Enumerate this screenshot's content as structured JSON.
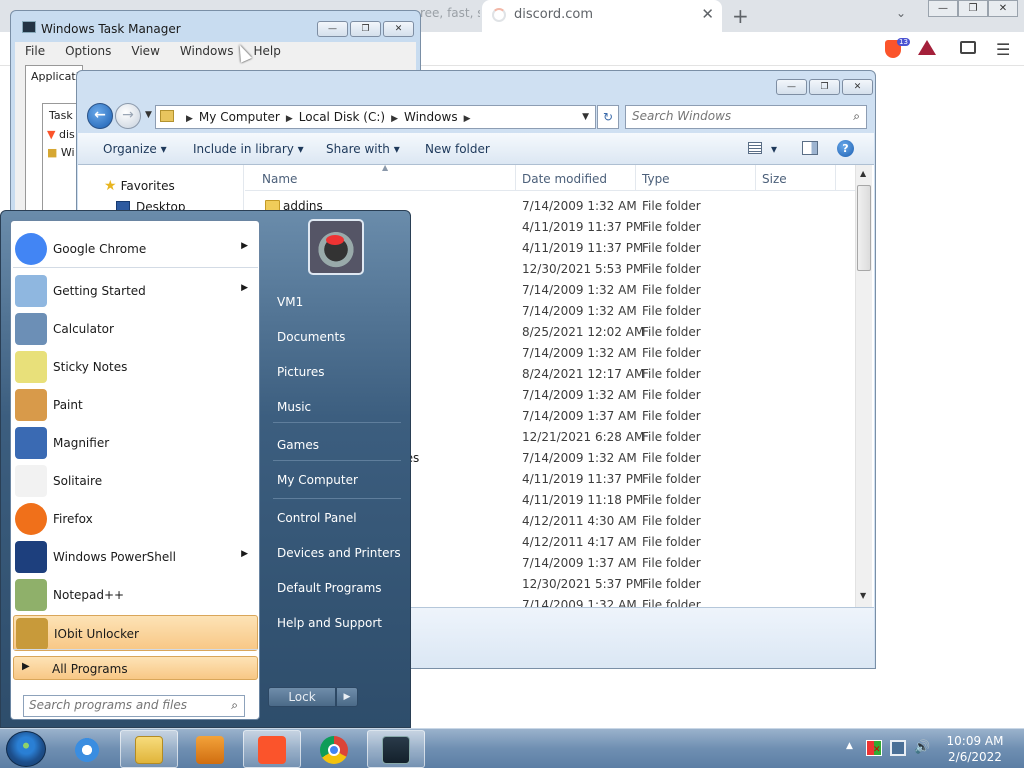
{
  "browser": {
    "faded_tab_text": "ree, fast, s",
    "tab_title": "discord.com",
    "tab_close": "✕",
    "new_tab": "+",
    "tab_list": "⌄",
    "window_buttons": [
      "—",
      "❐",
      "✕"
    ],
    "brave_shield_badge": "13"
  },
  "task_manager": {
    "title": "Windows Task Manager",
    "window_buttons": [
      "—",
      "❐",
      "✕"
    ],
    "menu": [
      "File",
      "Options",
      "View",
      "Windows",
      "Help"
    ],
    "active_tab": "Applications",
    "list_header": "Task",
    "rows": [
      "dis",
      "Wi"
    ]
  },
  "explorer": {
    "window_buttons": [
      "—",
      "❐",
      "✕"
    ],
    "back": "←",
    "forward": "→",
    "history_dropdown": "▼",
    "breadcrumb": [
      "My Computer",
      "Local Disk (C:)",
      "Windows"
    ],
    "refresh": "↻",
    "search_placeholder": "Search Windows",
    "commands": {
      "organize": "Organize ▾",
      "include_in_library": "Include in library ▾",
      "share_with": "Share with ▾",
      "new_folder": "New folder",
      "views_dropdown": "▾",
      "help": "?"
    },
    "nav_pane": {
      "favorites": "Favorites",
      "desktop": "Desktop"
    },
    "columns": [
      "Name",
      "Date modified",
      "Type",
      "Size"
    ],
    "files": [
      {
        "name": "addins",
        "date": "7/14/2009 1:32 AM",
        "type": "File folder"
      },
      {
        "name": "",
        "date": "4/11/2019 11:37 PM",
        "type": "File folder"
      },
      {
        "name": "",
        "date": "4/11/2019 11:37 PM",
        "type": "File folder"
      },
      {
        "name": "",
        "date": "12/30/2021 5:53 PM",
        "type": "File folder"
      },
      {
        "name": "",
        "date": "7/14/2009 1:32 AM",
        "type": "File folder"
      },
      {
        "name": "",
        "date": "7/14/2009 1:32 AM",
        "type": "File folder"
      },
      {
        "name": "",
        "date": "8/25/2021 12:02 AM",
        "type": "File folder"
      },
      {
        "name": "",
        "date": "7/14/2009 1:32 AM",
        "type": "File folder"
      },
      {
        "name": "",
        "date": "8/24/2021 12:17 AM",
        "type": "File folder"
      },
      {
        "name": "",
        "date": "7/14/2009 1:32 AM",
        "type": "File folder"
      },
      {
        "name": "",
        "date": "7/14/2009 1:37 AM",
        "type": "File folder"
      },
      {
        "name": "",
        "date": "12/21/2021 6:28 AM",
        "type": "File folder"
      },
      {
        "name": "des",
        "date": "7/14/2009 1:32 AM",
        "type": "File folder"
      },
      {
        "name": "",
        "date": "4/11/2019 11:37 PM",
        "type": "File folder"
      },
      {
        "name": "",
        "date": "4/11/2019 11:18 PM",
        "type": "File folder"
      },
      {
        "name": "",
        "date": "4/12/2011 4:30 AM",
        "type": "File folder"
      },
      {
        "name": "",
        "date": "4/12/2011 4:17 AM",
        "type": "File folder"
      },
      {
        "name": "",
        "date": "7/14/2009 1:37 AM",
        "type": "File folder"
      },
      {
        "name": "",
        "date": "12/30/2021 5:37 PM",
        "type": "File folder"
      },
      {
        "name": "",
        "date": "7/14/2009 1:32 AM",
        "type": "File folder"
      }
    ]
  },
  "start_menu": {
    "pinned": [
      {
        "label": "Google Chrome",
        "has_submenu": true,
        "icon": "chrome-icon"
      },
      {
        "label": "Getting Started",
        "has_submenu": true,
        "icon": "getting-started-icon"
      },
      {
        "label": "Calculator",
        "has_submenu": false,
        "icon": "calculator-icon"
      },
      {
        "label": "Sticky Notes",
        "has_submenu": false,
        "icon": "sticky-notes-icon"
      },
      {
        "label": "Paint",
        "has_submenu": false,
        "icon": "paint-icon"
      },
      {
        "label": "Magnifier",
        "has_submenu": false,
        "icon": "magnifier-icon"
      },
      {
        "label": "Solitaire",
        "has_submenu": false,
        "icon": "solitaire-icon"
      },
      {
        "label": "Firefox",
        "has_submenu": false,
        "icon": "firefox-icon"
      },
      {
        "label": "Windows PowerShell",
        "has_submenu": true,
        "icon": "powershell-icon"
      },
      {
        "label": "Notepad++",
        "has_submenu": false,
        "icon": "notepadpp-icon"
      },
      {
        "label": "IObit Unlocker",
        "has_submenu": false,
        "icon": "iobit-unlocker-icon"
      }
    ],
    "submenu_arrow": "▶",
    "all_programs": "All Programs",
    "all_programs_arrow": "▶",
    "search_placeholder": "Search programs and files",
    "user_name": "VM1",
    "right_items": [
      "Documents",
      "Pictures",
      "Music",
      "Games",
      "My Computer",
      "Control Panel",
      "Devices and Printers",
      "Default Programs",
      "Help and Support"
    ],
    "lock_label": "Lock",
    "lock_arrow": "▶"
  },
  "taskbar": {
    "time": "10:09 AM",
    "date": "2/6/2022",
    "tray_arrow": "▲",
    "volume": "🔊"
  },
  "colors": {
    "explorer_frame": "#cfe0f2",
    "start_menu_highlight": "#f8c785",
    "taskbar": "#6f8fb2"
  }
}
